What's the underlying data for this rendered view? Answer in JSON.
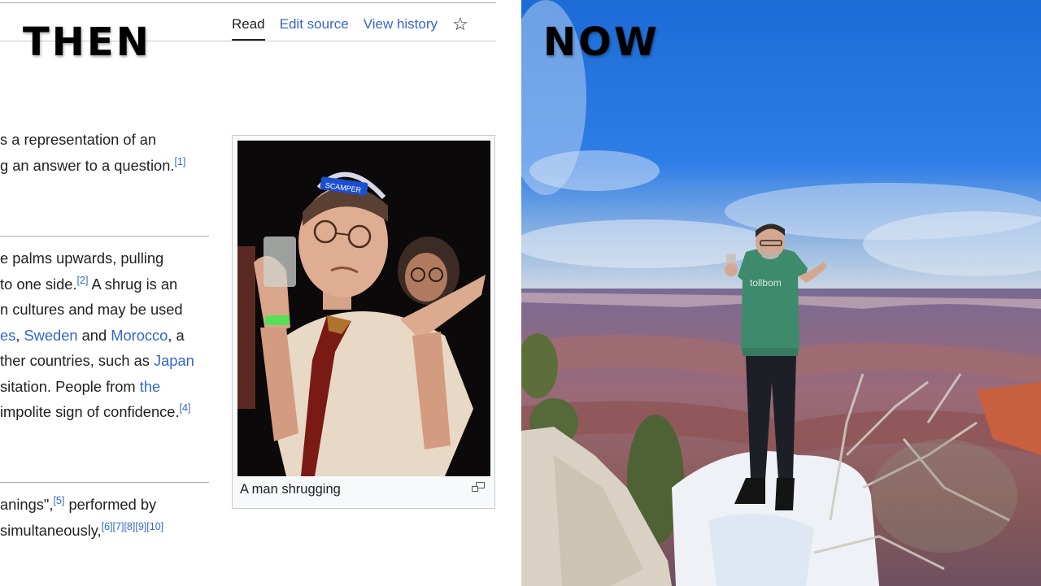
{
  "labels": {
    "then": "THEN",
    "now": "NOW"
  },
  "wiki": {
    "tabs": [
      {
        "label": "Read",
        "active": true
      },
      {
        "label": "Edit source",
        "active": false
      },
      {
        "label": "View history",
        "active": false
      }
    ],
    "watch_icon": "star-outline-icon",
    "paragraph1": {
      "line1": "s a representation of an",
      "line2": "g an answer to a question.",
      "ref1": "[1]"
    },
    "paragraph2": {
      "line1": "e palms upwards, pulling",
      "line2a": "to one side.",
      "ref2": "[2]",
      "line2b": " A shrug is an",
      "line3": "n cultures and may be used",
      "line4_link1": "es",
      "line4_sep1": ", ",
      "line4_link2": "Sweden",
      "line4_mid": " and ",
      "line4_link3": "Morocco",
      "line4_end": ", a",
      "line5a": "ther countries, such as ",
      "line5_link": "Japan",
      "line6a": "sitation. People from ",
      "line6_link": "the",
      "line7": "impolite sign of confidence.",
      "ref4": "[4]"
    },
    "paragraph3": {
      "line1a": "anings\",",
      "ref5": "[5]",
      "line1b": " performed by",
      "line2": " simultaneously,",
      "refs": [
        "[6]",
        "[7]",
        "[8]",
        "[9]",
        "[10]"
      ]
    },
    "figure": {
      "caption": "A man shrugging",
      "badge_text": "SCAMPER",
      "enlarge_icon": "magnify-clip-icon"
    }
  },
  "photo_now": {
    "hoodie_text": "tollbom"
  },
  "colors": {
    "link": "#3366cc",
    "text": "#202122",
    "divider": "#a2a9b1",
    "sky": "#1f6fd8"
  }
}
